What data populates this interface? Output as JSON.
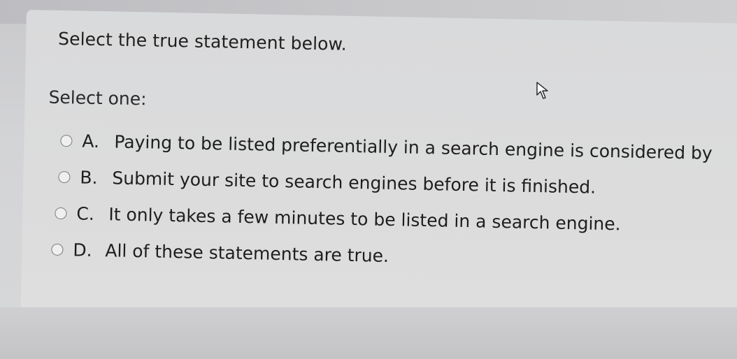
{
  "question": {
    "prompt": "Select the true statement below.",
    "instruction": "Select one:"
  },
  "options": [
    {
      "letter": "A.",
      "text": "Paying to be listed preferentially in a search engine is considered by"
    },
    {
      "letter": "B.",
      "text": "Submit your site to search engines before it is finished."
    },
    {
      "letter": "C.",
      "text": "It only takes a few minutes to be listed in a search engine."
    },
    {
      "letter": "D.",
      "text": "All of these statements are true."
    }
  ],
  "icons": {
    "cursor": "mouse-pointer-icon",
    "radio": "radio-unselected-icon"
  }
}
